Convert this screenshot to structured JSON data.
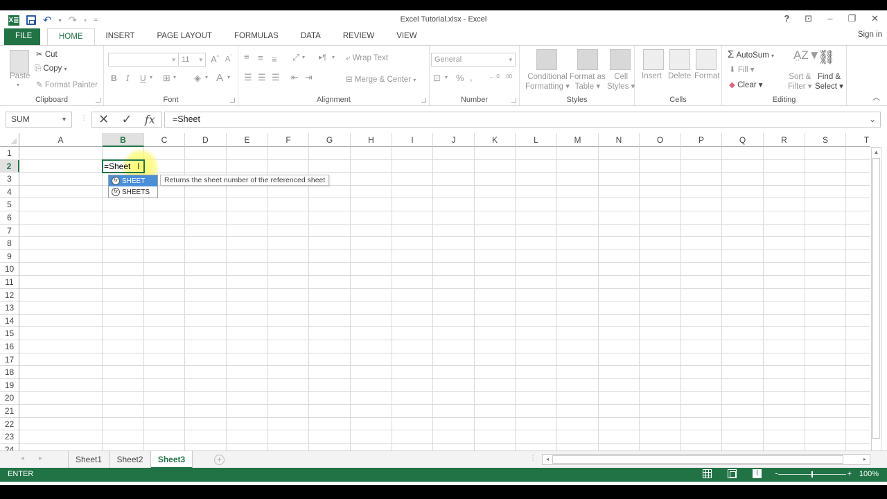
{
  "window": {
    "title": "Excel Tutorial.xlsx - Excel",
    "controls": [
      "?",
      "ribbon-display",
      "minimize",
      "restore",
      "close"
    ],
    "sign_in": "Sign in"
  },
  "qat": {
    "logo": "X≣",
    "undo": "↶",
    "redo": "↷",
    "customize": "="
  },
  "tabs": [
    {
      "label": "FILE"
    },
    {
      "label": "HOME"
    },
    {
      "label": "INSERT"
    },
    {
      "label": "PAGE LAYOUT"
    },
    {
      "label": "FORMULAS"
    },
    {
      "label": "DATA"
    },
    {
      "label": "REVIEW"
    },
    {
      "label": "VIEW"
    }
  ],
  "ribbon": {
    "clipboard": {
      "label": "Clipboard",
      "paste": "Paste",
      "cut": "Cut",
      "copy": "Copy",
      "format_painter": "Format Painter"
    },
    "font": {
      "label": "Font",
      "font_name": "",
      "font_size": "11",
      "bold": "B",
      "italic": "I",
      "underline": "U"
    },
    "alignment": {
      "label": "Alignment",
      "wrap_text": "Wrap Text",
      "merge_center": "Merge & Center"
    },
    "number": {
      "label": "Number",
      "format": "General",
      "percent": "%",
      "comma": ",",
      "inc_dec": "←.0 .00",
      "dec_dec": ".00 →.0"
    },
    "styles": {
      "label": "Styles",
      "conditional": [
        "Conditional",
        "Formatting ▾"
      ],
      "format_table": [
        "Format as",
        "Table ▾"
      ],
      "cell_styles": [
        "Cell",
        "Styles ▾"
      ]
    },
    "cells": {
      "label": "Cells",
      "insert": "Insert",
      "delete": "Delete",
      "format": "Format"
    },
    "editing": {
      "label": "Editing",
      "autosum": "AutoSum",
      "fill": "Fill ▾",
      "clear": "Clear ▾",
      "sort": [
        "Sort &",
        "Filter ▾"
      ],
      "find": [
        "Find &",
        "Select ▾"
      ]
    }
  },
  "formula_bar": {
    "name_box": "SUM",
    "cancel": "✕",
    "enter": "✓",
    "fx": "fx",
    "content": "=Sheet"
  },
  "grid": {
    "columns": [
      "A",
      "B",
      "C",
      "D",
      "E",
      "F",
      "G",
      "H",
      "I",
      "J",
      "K",
      "L",
      "M",
      "N",
      "O",
      "P",
      "Q",
      "R",
      "S",
      "T"
    ],
    "rows": [
      "1",
      "2",
      "3",
      "4",
      "5",
      "6",
      "7",
      "8",
      "9",
      "10",
      "11",
      "12",
      "13",
      "14",
      "15",
      "16",
      "17",
      "18",
      "19",
      "20",
      "21",
      "22",
      "23",
      "24"
    ],
    "selected_column": "B",
    "selected_row": "2",
    "active_cell_value": "=Sheet"
  },
  "autocomplete": {
    "items": [
      {
        "label": "SHEET",
        "selected": true
      },
      {
        "label": "SHEETS",
        "selected": false
      }
    ],
    "tooltip": "Returns the sheet number of the referenced sheet"
  },
  "sheets": [
    {
      "label": "Sheet1"
    },
    {
      "label": "Sheet2"
    },
    {
      "label": "Sheet3",
      "active": true
    }
  ],
  "status": {
    "mode": "ENTER",
    "zoom": "100%",
    "zoom_level_percent": 100
  },
  "colors": {
    "accent": "#217346",
    "selection": "#4a8fd8"
  }
}
